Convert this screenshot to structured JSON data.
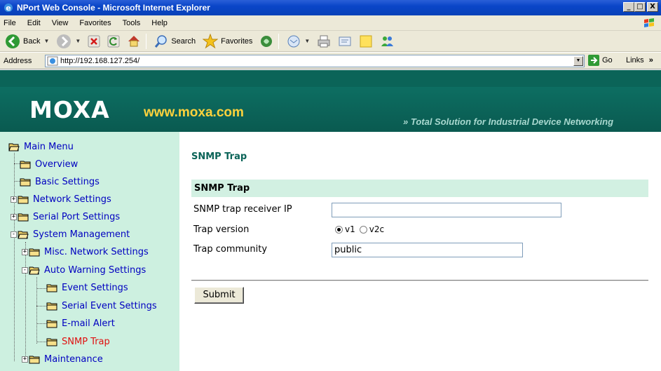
{
  "window": {
    "title": "NPort Web Console - Microsoft Internet Explorer",
    "controls": [
      "_",
      "□",
      "X"
    ]
  },
  "menubar": {
    "items": [
      "File",
      "Edit",
      "View",
      "Favorites",
      "Tools",
      "Help"
    ]
  },
  "toolbar": {
    "back_label": "Back",
    "search_label": "Search",
    "favorites_label": "Favorites"
  },
  "addressbar": {
    "label": "Address",
    "url": "http://192.168.127.254/",
    "go_label": "Go",
    "links_label": "Links",
    "links_chevron": "»"
  },
  "banner": {
    "logo": "MOXA",
    "url": "www.moxa.com",
    "tagline": "Total Solution for Industrial Device Networking",
    "tagline_prefix": "»"
  },
  "sidebar": {
    "items": [
      {
        "label": "Main Menu",
        "level": 0
      },
      {
        "label": "Overview",
        "level": 1
      },
      {
        "label": "Basic Settings",
        "level": 1
      },
      {
        "label": "Network Settings",
        "level": 1,
        "expander": "+"
      },
      {
        "label": "Serial Port Settings",
        "level": 1,
        "expander": "+"
      },
      {
        "label": "System Management",
        "level": 1,
        "expander": "-"
      },
      {
        "label": "Misc. Network Settings",
        "level": 2,
        "expander": "+"
      },
      {
        "label": "Auto Warning Settings",
        "level": 2,
        "expander": "-"
      },
      {
        "label": "Event Settings",
        "level": 3
      },
      {
        "label": "Serial Event Settings",
        "level": 3
      },
      {
        "label": "E-mail Alert",
        "level": 3
      },
      {
        "label": "SNMP Trap",
        "level": 3,
        "active": true
      },
      {
        "label": "Maintenance",
        "level": 2,
        "expander": "+"
      }
    ]
  },
  "main": {
    "page_title": "SNMP Trap",
    "section_title": "SNMP Trap",
    "receiver_ip_label": "SNMP trap receiver IP",
    "receiver_ip_value": "",
    "trap_version_label": "Trap version",
    "version_v1": "v1",
    "version_v2c": "v2c",
    "selected_version": "v1",
    "community_label": "Trap community",
    "community_value": "public",
    "submit_label": "Submit"
  },
  "colors": {
    "banner": "#0d6e62",
    "sidebar": "#cdf0e0",
    "link": "#0000c0",
    "active_link": "#e01010",
    "logo_url": "#ffd23c"
  }
}
